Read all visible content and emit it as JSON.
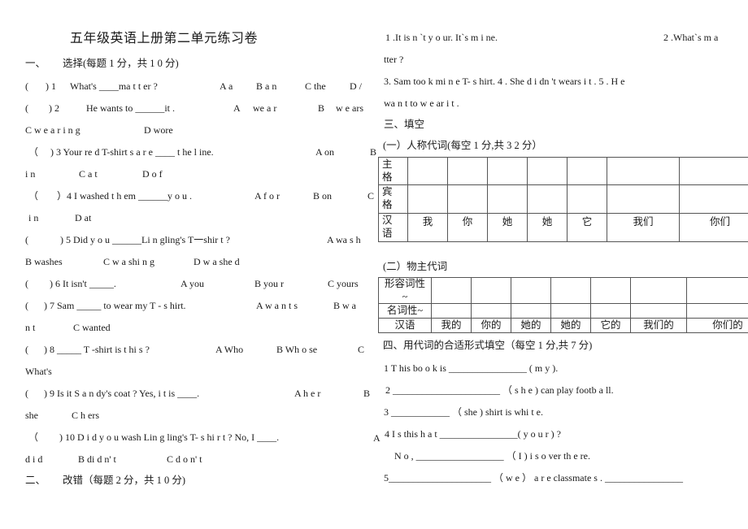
{
  "title": "五年级英语上册第二单元练习卷",
  "section1": {
    "heading_num": "一、",
    "heading": "选择(每题 1 分，共 1 0 分)",
    "lines": [
      [
        "(",
        ") 1",
        "What's ____ma t t er  ?",
        "A a",
        "B a n",
        "C the",
        "D  /"
      ],
      [
        "(",
        ")  2",
        "He   wants  to ______it .",
        "A",
        "we a r",
        "B",
        "w e ars"
      ],
      [
        "C  w e a r i n g",
        "D wore"
      ],
      [
        "（",
        ")  3 Your re d  T-shirt s  a r e ____ t he  l ine.",
        "A on",
        "B"
      ],
      [
        "i n",
        "C   a t",
        "D  o f"
      ],
      [
        "（",
        "）4 I washed t h em  ______y o u .",
        "A f o r",
        "B on",
        "C"
      ],
      [
        "i n",
        "D   at"
      ],
      [
        "(",
        ")   5  Did  y o u  ______Li n gling's   T一shir t    ?",
        "A wa s  h"
      ],
      [
        "B washes",
        "C w a shi n  g",
        "D   w a she d"
      ],
      [
        "(",
        ")  6   It isn't _____.",
        "A you",
        "B   you r",
        "C   yours"
      ],
      [
        "(",
        ")  7   Sam _____ to wear   my  T - s hirt.",
        "A w a n t s",
        "B   w a"
      ],
      [
        "n t",
        "C wanted"
      ],
      [
        "(",
        ") 8 _____  T -shirt is   t hi s   ?",
        "A Who",
        "B Wh o se",
        "C"
      ],
      [
        "What's"
      ],
      [
        "(",
        ") 9 Is it  S a n dy's   coat ?   Yes,    i t is ____.",
        "A   h e r",
        "B"
      ],
      [
        "she",
        "C    h ers"
      ],
      [
        "（",
        ") 10 D i d   y o u   wash Lin g ling's T- s hi r t    ?   No, I   ____.",
        "A"
      ],
      [
        "d i d",
        "B di d n' t",
        "C d o n' t"
      ]
    ]
  },
  "section2": {
    "heading_num": "二、",
    "heading": "改错（每题 2 分，共 1  0 分)",
    "items": [
      "1   .It is n `t y o ur.     It`s   m i ne.",
      "2 .What`s       m a",
      "tter ?",
      "3. Sam too k    mi n e   T- s hirt.     4 .    She d i dn  't wears   i t .   5 .  H e",
      "wa n  t   to    w e ar i t ."
    ]
  },
  "section3": {
    "heading": "三、填空",
    "part1": {
      "heading": "(一）人称代词(每空 1 分,共 3 2 分）",
      "row_labels": [
        "主\n格",
        "宾\n格",
        "汉\n语"
      ],
      "chinese": [
        "我",
        "你",
        "她",
        "她",
        "它",
        "我们",
        "你们"
      ]
    },
    "part2": {
      "heading": "(二）物主代词",
      "row_labels": [
        "形容词性\n~",
        "名词性~",
        "汉语"
      ],
      "chinese": [
        "我的",
        "你的",
        "她的",
        "她的",
        "它的",
        "我们的",
        "你们的"
      ]
    }
  },
  "section4": {
    "heading": "四、用代词的合适形式填空（每空 1 分,共 7 分)",
    "items": [
      "1   T his    bo o k is ________________ ( m y ).",
      "2   ______________________ （  s  h e   ) can play    footb a ll.",
      "3 ____________  （  she ) shirt is whi t e.",
      "4   I s this   h a t    ________________(   y o u r    ) ?",
      "N o ,   __________________  （  I   ) i s    o ver th e re.",
      "5_____________________  （  w e  ）  a r e classmate s      .     ________________"
    ],
    "stray_marker": "A"
  }
}
